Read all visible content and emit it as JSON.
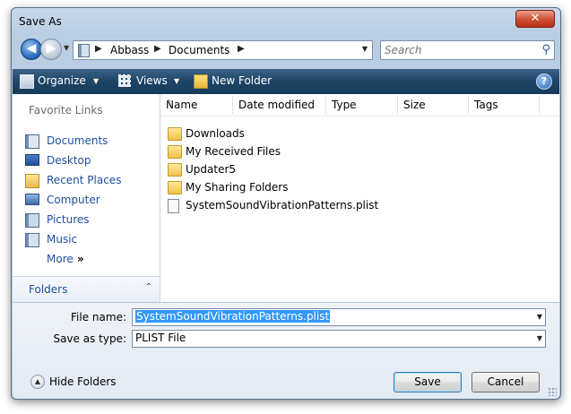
{
  "window": {
    "title": "Save As",
    "close_glyph": "✕"
  },
  "address_bar": {
    "back_glyph": "◀",
    "forward_glyph": "▶",
    "breadcrumbs": [
      "Abbass",
      "Documents"
    ],
    "separator_glyph": "▶",
    "dropdown_glyph": "▼",
    "refresh_glyph": "↻"
  },
  "search": {
    "placeholder": "Search",
    "icon": "search-icon",
    "glyph": "⚲"
  },
  "toolbar": {
    "organize_label": "Organize",
    "views_label": "Views",
    "new_folder_label": "New Folder",
    "dropdown_glyph": "▼",
    "help_glyph": "?"
  },
  "favorite_links": {
    "header": "Favorite Links",
    "items": [
      {
        "label": "Documents",
        "icon": "documents-icon"
      },
      {
        "label": "Desktop",
        "icon": "desktop-icon"
      },
      {
        "label": "Recent Places",
        "icon": "recent-places-icon"
      },
      {
        "label": "Computer",
        "icon": "computer-icon"
      },
      {
        "label": "Pictures",
        "icon": "pictures-icon"
      },
      {
        "label": "Music",
        "icon": "music-icon"
      },
      {
        "label": "More",
        "suffix": "»"
      }
    ]
  },
  "folders_bar": {
    "label": "Folders",
    "chevron": "⌃"
  },
  "columns": [
    "Name",
    "Date modified",
    "Type",
    "Size",
    "Tags"
  ],
  "sort_caret": "^",
  "files": [
    {
      "name": "Downloads",
      "icon": "folder-icon"
    },
    {
      "name": "My Received Files",
      "icon": "folder-icon"
    },
    {
      "name": "Updater5",
      "icon": "folder-icon"
    },
    {
      "name": "My Sharing Folders",
      "icon": "shared-folder-icon"
    },
    {
      "name": "SystemSoundVibrationPatterns.plist",
      "icon": "file-icon"
    }
  ],
  "form": {
    "file_name_label": "File name:",
    "file_name_value": "SystemSoundVibrationPatterns.plist",
    "save_as_type_label": "Save as type:",
    "save_as_type_value": "PLIST File",
    "dropdown_glyph": "▼"
  },
  "footer": {
    "hide_folders_label": "Hide Folders",
    "hide_glyph": "▲",
    "save_label": "Save",
    "cancel_label": "Cancel"
  },
  "colors": {
    "link": "#1f4fa0",
    "toolbar": "#1e4566",
    "selection": "#3399ff",
    "close": "#cf4d33"
  }
}
